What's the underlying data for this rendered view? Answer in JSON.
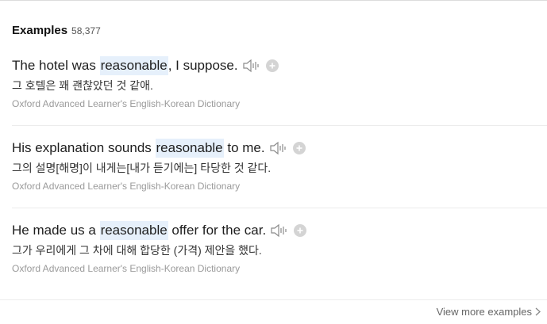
{
  "header": {
    "title": "Examples",
    "count": "58,377"
  },
  "examples": [
    {
      "before": "The hotel was ",
      "highlight": "reasonable",
      "after": ", I suppose.",
      "translation": "그 호텔은 꽤 괜찮았던 것 같애.",
      "source": "Oxford Advanced Learner's English-Korean Dictionary"
    },
    {
      "before": "His explanation sounds ",
      "highlight": "reasonable",
      "after": " to me.",
      "translation": "그의 설명[해명]이 내게는[내가 듣기에는] 타당한 것 같다.",
      "source": "Oxford Advanced Learner's English-Korean Dictionary"
    },
    {
      "before": "He made us a ",
      "highlight": "reasonable",
      "after": " offer for the car.",
      "translation": "그가 우리에게 그 차에 대해 합당한 (가격) 제안을 했다.",
      "source": "Oxford Advanced Learner's English-Korean Dictionary"
    }
  ],
  "footer": {
    "more_label": "View more examples"
  },
  "icons": {
    "speaker": "speaker-icon",
    "add": "plus-circle-icon",
    "more": "chevron-right-icon"
  },
  "colors": {
    "highlight": "#e6f0fb",
    "source_text": "#9a9a9a",
    "plus_circle": "#d4d4d4"
  }
}
